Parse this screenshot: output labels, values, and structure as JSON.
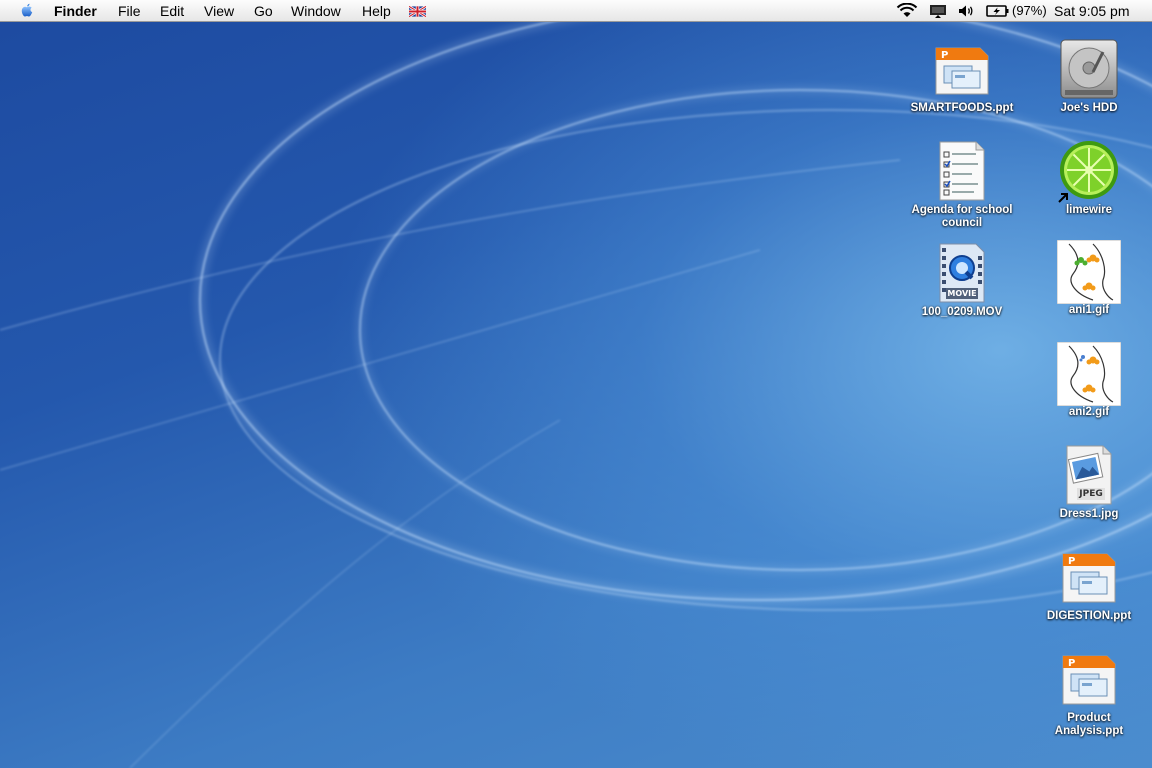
{
  "menubar": {
    "app_name": "Finder",
    "menus": [
      "File",
      "Edit",
      "View",
      "Go",
      "Window",
      "Help"
    ],
    "input_flag_icon": "uk-flag-icon",
    "status": {
      "icons": [
        "wifi-icon",
        "display-icon",
        "volume-icon",
        "battery-icon"
      ],
      "battery_percent": "(97%)",
      "clock": "Sat 9:05 pm"
    }
  },
  "desktop": {
    "icons": [
      {
        "label": "SMARTFOODS.ppt",
        "kind": "powerpoint-file-icon"
      },
      {
        "label": "Joe's HDD",
        "kind": "hard-drive-icon"
      },
      {
        "label": "Agenda for school council",
        "kind": "checklist-document-icon"
      },
      {
        "label": "limewire",
        "kind": "limewire-alias-icon"
      },
      {
        "label": "100_0209.MOV",
        "kind": "quicktime-movie-icon",
        "badge": "MOVIE"
      },
      {
        "label": "ani1.gif",
        "kind": "gif-image-icon"
      },
      {
        "label": "ani2.gif",
        "kind": "gif-image-icon"
      },
      {
        "label": "Dress1.jpg",
        "kind": "jpeg-file-icon",
        "badge": "JPEG"
      },
      {
        "label": "DIGESTION.ppt",
        "kind": "powerpoint-file-icon"
      },
      {
        "label": "Product Analysis.ppt",
        "kind": "powerpoint-file-icon"
      }
    ]
  },
  "colors": {
    "wallpaper_dark": "#1d4aa0",
    "wallpaper_light": "#4b8ccd",
    "ppt_orange": "#f07a10",
    "limewire_green": "#5ec21c"
  }
}
